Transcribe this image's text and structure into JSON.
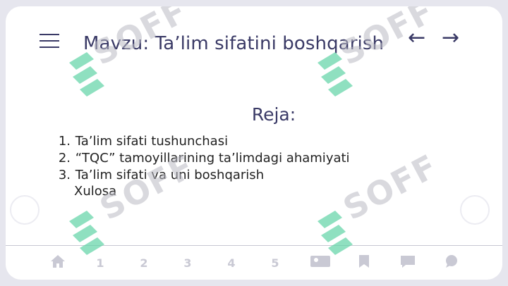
{
  "header": {
    "title": "Mavzu: Ta’lim sifatini boshqarish",
    "prev_arrow": "←",
    "next_arrow": "→",
    "menu_icon": "hamburger-menu-icon"
  },
  "plan": {
    "heading": "Reja:",
    "items": [
      {
        "num": "1.",
        "text": "Ta’lim sifati tushunchasi"
      },
      {
        "num": "2.",
        "text": "“TQC” tamoyillarining ta’limdagi ahamiyati"
      },
      {
        "num": "3.",
        "text": "Ta’lim sifati va uni boshqarish"
      }
    ],
    "extra": "Xulosa"
  },
  "bottom_bar": {
    "items": [
      "1",
      "2",
      "3",
      "4",
      "5"
    ],
    "icons": [
      "home-icon",
      "gallery-icon",
      "bookmark-icon",
      "chat-icon",
      "comment-icon"
    ]
  },
  "watermark": {
    "text": "SOFF",
    "color": "#5fd3a5"
  },
  "colors": {
    "title": "#3a3a66",
    "background": "#e6e6ee",
    "card": "#ffffff"
  }
}
